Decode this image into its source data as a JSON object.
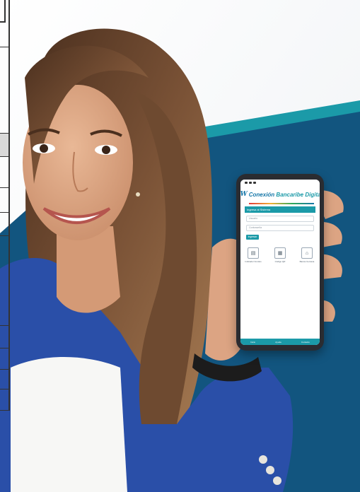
{
  "phone_app": {
    "brand_mark": "lW",
    "brand_prefix": "Conexión ",
    "brand_suffix": "Bancaribe Digital",
    "section_title": "Ingresa al Sistema",
    "username_placeholder": "Usuario",
    "password_placeholder": "Contraseña",
    "login_button": "Ingresar",
    "shortcuts": [
      {
        "label": "Indicador Fondos",
        "icon": "document-icon"
      },
      {
        "label": "Código QR",
        "icon": "qr-icon"
      },
      {
        "label": "Banca Cercana",
        "icon": "location-icon"
      }
    ],
    "nav_items": [
      "Inicio",
      "Ayuda",
      "Contacto"
    ]
  },
  "colors": {
    "teal": "#1b9aa8",
    "navy_blue": "#12557f",
    "brand_blue": "#1677a8",
    "jacket_blue": "#2a4fa8"
  }
}
